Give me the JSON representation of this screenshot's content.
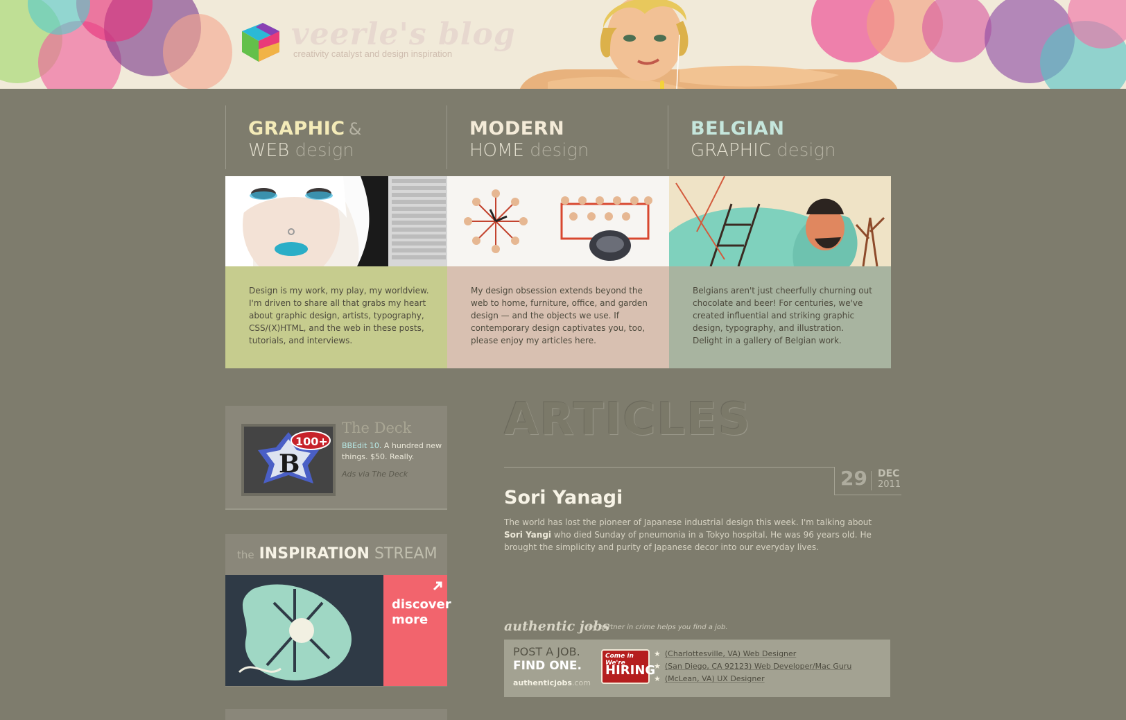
{
  "header": {
    "logo_title": "veerle's blog",
    "tagline": "creativity catalyst and design inspiration"
  },
  "categories": [
    {
      "line1": "GRAPHIC",
      "amp": "&",
      "line2a": "WEB",
      "line2b": "design"
    },
    {
      "line1": "MODERN",
      "amp": "",
      "line2a": "HOME",
      "line2b": "design"
    },
    {
      "line1": "BELGIAN",
      "amp": "",
      "line2a": "GRAPHIC",
      "line2b": "design"
    }
  ],
  "tiles": [
    {
      "text": "Design is my work, my play, my worldview. I'm driven to share all that grabs my heart about graphic design, artists, typography, CSS/(X)HTML, and the web in these posts, tutorials, and interviews."
    },
    {
      "text": "My design obsession extends beyond the web to home, furniture, office, and garden design — and the objects we use. If contemporary design captivates you, too, please enjoy my articles here."
    },
    {
      "text": "Belgians aren't just cheerfully churning out chocolate and beer! For centuries, we've created influential and striking graphic design, typography, and illustration. Delight in a gallery of Belgian work."
    }
  ],
  "ad": {
    "title": "The Deck",
    "link": "BBEdit 10.",
    "text": " A hundred new things. $50. Really.",
    "via": "Ads via The Deck",
    "badge": "100+"
  },
  "inspiration": {
    "the": "the",
    "main": "INSPIRATION",
    "stream": "STREAM",
    "more_line1": "discover",
    "more_line2": "more"
  },
  "main": {
    "heading": "ARTICLES",
    "date": {
      "day": "29",
      "month": "DEC",
      "year": "2011"
    },
    "post_title": "Sori Yanagi",
    "excerpt_pre": "The world has lost the pioneer of Japanese industrial design this week. I'm talking about ",
    "excerpt_bold": "Sori Yangi",
    "excerpt_post": " who died Sunday of pneumonia in a Tokyo hospital. He was 96 years old. He brought the simplicity and purity of Japanese decor into our everyday lives."
  },
  "authentic_jobs": {
    "head": "authentic jobs",
    "sub": "my partner in crime helps you find a job.",
    "post": "POST A JOB.",
    "find": "FIND ONE.",
    "url_main": "authenticjobs",
    "url_tld": ".com",
    "badge_top": "Come in We're",
    "badge_main": "HIRING",
    "jobs": [
      "(Charlottesville, VA) Web Designer",
      "(San Diego, CA 92123) Web Developer/Mac Guru",
      "(McLean, VA) UX Designer"
    ]
  },
  "colors": {
    "background": "#7e7c6d",
    "header_bg": "#f1ead9",
    "tile_green": "#c6cc8e",
    "tile_rose": "#d8c0b1",
    "tile_sage": "#a8b4a0",
    "discover_pink": "#f2646d"
  }
}
